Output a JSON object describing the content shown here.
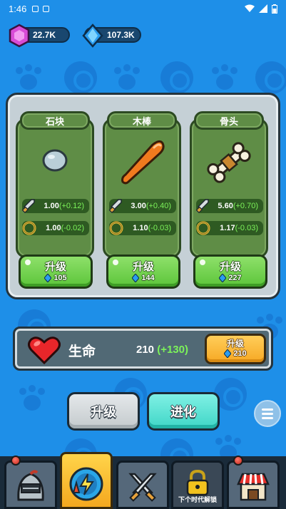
{
  "status_bar": {
    "time": "1:46"
  },
  "currency": {
    "gems": "22.7K",
    "diamonds": "107.3K"
  },
  "weapons": [
    {
      "name": "石块",
      "attack": "1.00",
      "attack_delta": "(+0.12)",
      "speed": "1.00",
      "speed_delta": "(-0.02)",
      "upgrade_label": "升级",
      "cost": "105"
    },
    {
      "name": "木棒",
      "attack": "3.00",
      "attack_delta": "(+0.40)",
      "speed": "1.10",
      "speed_delta": "(-0.03)",
      "upgrade_label": "升级",
      "cost": "144"
    },
    {
      "name": "骨头",
      "attack": "5.60",
      "attack_delta": "(+0.70)",
      "speed": "1.17",
      "speed_delta": "(-0.03)",
      "upgrade_label": "升级",
      "cost": "227"
    }
  ],
  "life": {
    "label": "生命",
    "value": "210",
    "delta": "(+130)",
    "upgrade_label": "升级",
    "cost": "210"
  },
  "actions": {
    "upgrade": "升级",
    "evolve": "进化"
  },
  "nav": {
    "locked_label": "下个时代解锁"
  },
  "colors": {
    "background": "#1e8fe8",
    "green_button": "#5cc53a",
    "orange_button": "#f6a824",
    "delta_green": "#7cf25a"
  }
}
